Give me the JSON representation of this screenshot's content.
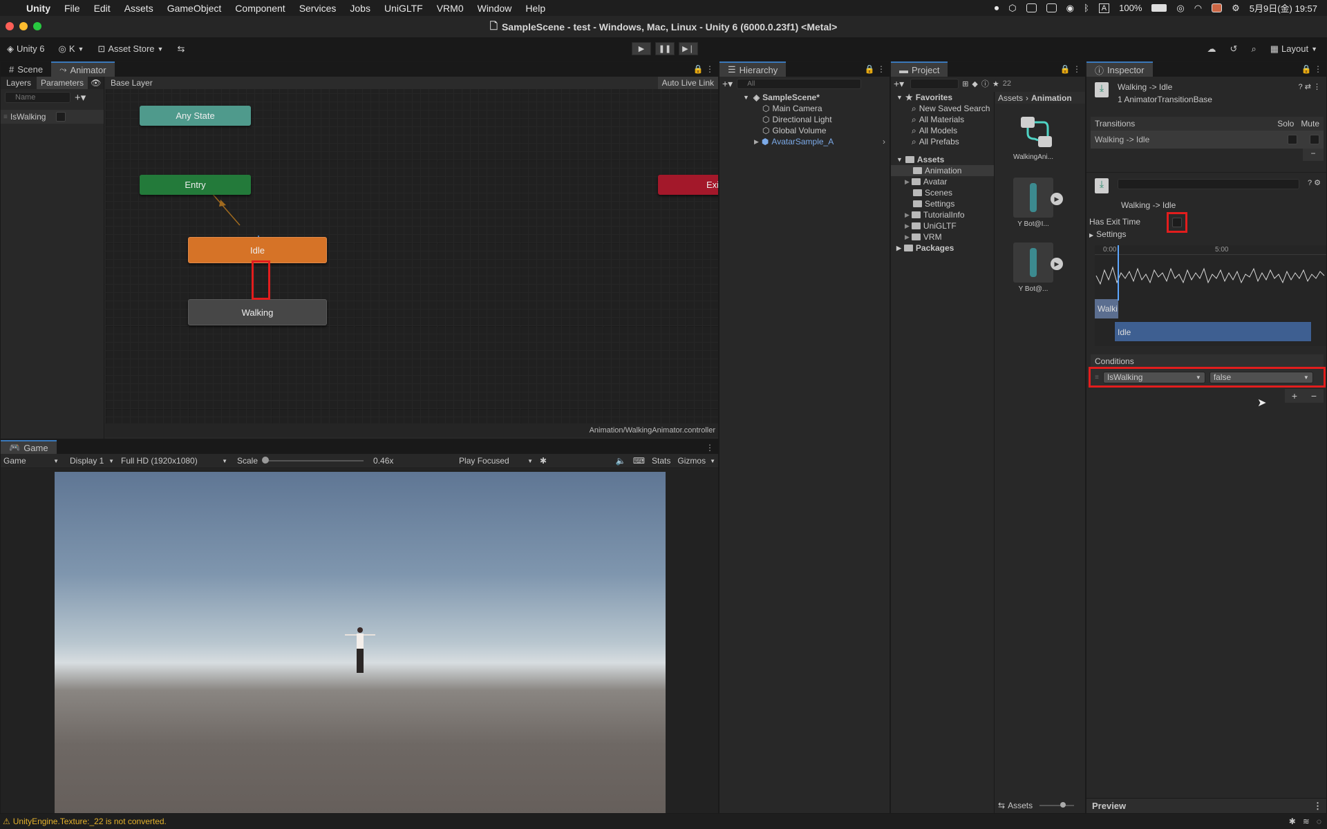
{
  "menubar": {
    "app": "Unity",
    "items": [
      "File",
      "Edit",
      "Assets",
      "GameObject",
      "Component",
      "Services",
      "Jobs",
      "UniGLTF",
      "VRM0",
      "Window",
      "Help"
    ],
    "battery": "100%",
    "datetime": "5月9日(金)  19:57",
    "input_indicator": "A"
  },
  "window": {
    "title": "SampleScene - test - Windows, Mac, Linux - Unity 6 (6000.0.23f1) <Metal>"
  },
  "toolbar": {
    "unity_label": "Unity 6",
    "account": "K",
    "asset_store": "Asset Store",
    "layout": "Layout"
  },
  "animator": {
    "tabs": [
      "Scene",
      "Animator"
    ],
    "sub_tabs": [
      "Layers",
      "Parameters"
    ],
    "breadcrumb": "Base Layer",
    "auto_live_link": "Auto Live Link",
    "search_placeholder": "Name",
    "parameter": {
      "name": "IsWalking",
      "value": false
    },
    "nodes": {
      "any_state": "Any State",
      "entry": "Entry",
      "exit": "Exit",
      "idle": "Idle",
      "walking": "Walking"
    },
    "path": "Animation/WalkingAnimator.controller"
  },
  "game": {
    "tab": "Game",
    "mode": "Game",
    "display": "Display 1",
    "resolution": "Full HD (1920x1080)",
    "scale_label": "Scale",
    "scale_value": "0.46x",
    "play_focused": "Play Focused",
    "stats": "Stats",
    "gizmos": "Gizmos"
  },
  "hierarchy": {
    "tab": "Hierarchy",
    "search_placeholder": "All",
    "scene": "SampleScene*",
    "items": [
      "Main Camera",
      "Directional Light",
      "Global Volume",
      "AvatarSample_A"
    ]
  },
  "project": {
    "tab": "Project",
    "count": "22",
    "favorites_label": "Favorites",
    "favorites": [
      "New Saved Search",
      "All Materials",
      "All Models",
      "All Prefabs"
    ],
    "assets_label": "Assets",
    "folders": [
      "Animation",
      "Avatar",
      "Scenes",
      "Settings",
      "TutorialInfo",
      "UniGLTF",
      "VRM"
    ],
    "packages_label": "Packages",
    "breadcrumb": [
      "Assets",
      "Animation"
    ],
    "files": [
      "WalkingAni...",
      "Y Bot@I...",
      "Y Bot@..."
    ],
    "footer": "Assets"
  },
  "inspector": {
    "tab": "Inspector",
    "title": "Walking -> Idle",
    "subtitle": "1 AnimatorTransitionBase",
    "transitions_label": "Transitions",
    "solo": "Solo",
    "mute": "Mute",
    "transition_row": "Walking -> Idle",
    "transition_name": "Walking -> Idle",
    "has_exit_time_label": "Has Exit Time",
    "has_exit_time": false,
    "settings_label": "Settings",
    "timeline": {
      "t0": "0:00",
      "t1": "5:00",
      "clip_from": "Walki",
      "clip_to": "Idle"
    },
    "conditions_label": "Conditions",
    "condition": {
      "param": "IsWalking",
      "value": "false"
    },
    "preview": "Preview"
  },
  "status": {
    "message": "UnityEngine.Texture:_22 is not converted."
  }
}
